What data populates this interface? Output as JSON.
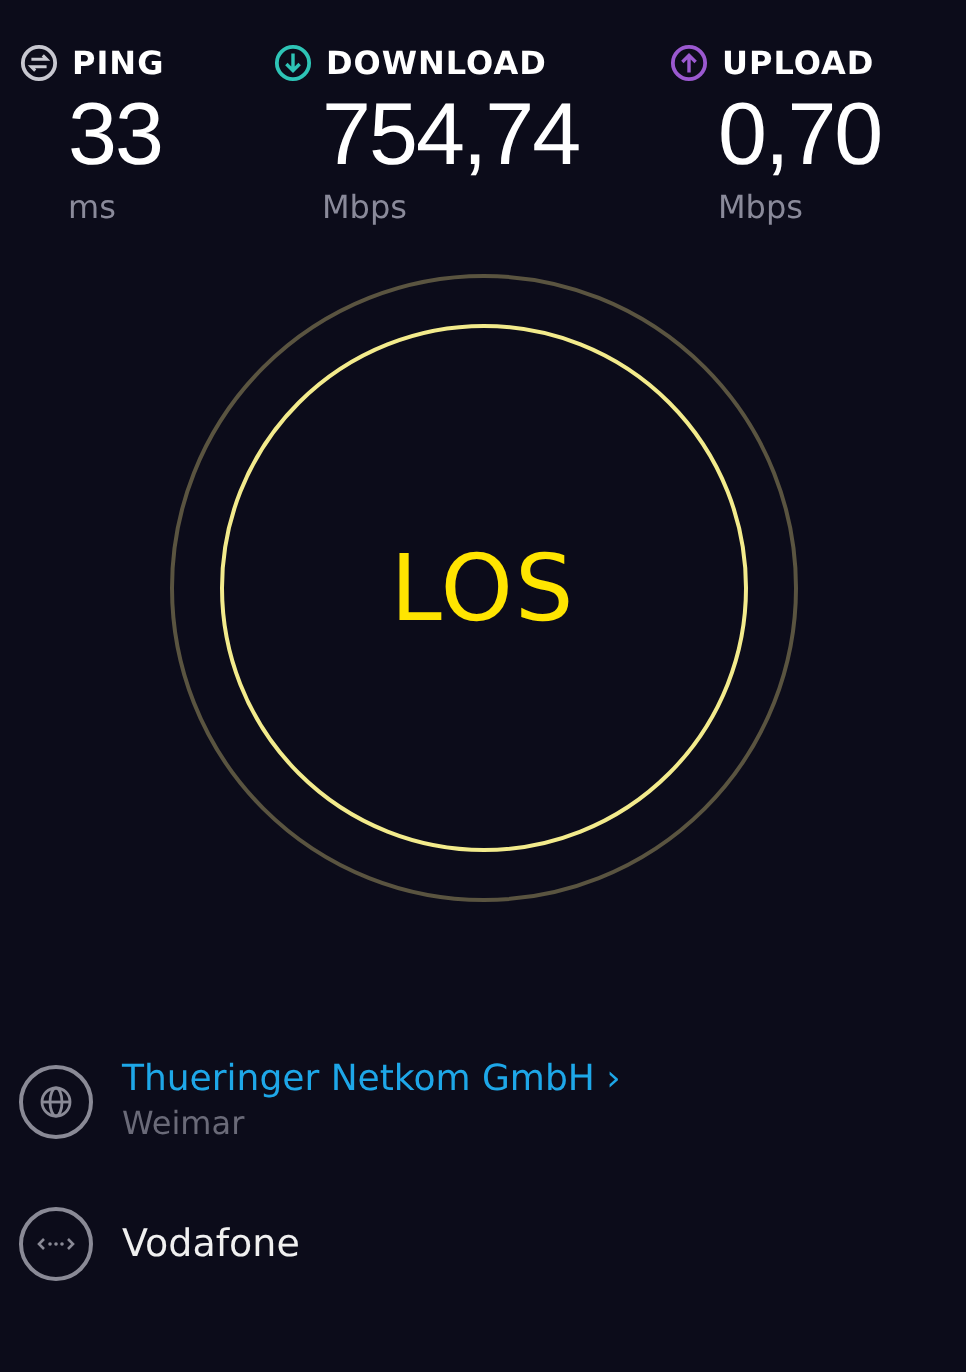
{
  "metrics": [
    {
      "kind": "ping",
      "label": "PING",
      "value": "33",
      "unit": "ms"
    },
    {
      "kind": "download",
      "label": "DOWNLOAD",
      "value": "754,74",
      "unit": "Mbps"
    },
    {
      "kind": "upload",
      "label": "UPLOAD",
      "value": "0,70",
      "unit": "Mbps"
    }
  ],
  "start_button": {
    "label": "LOS"
  },
  "provider": {
    "name": "Thueringer Netkom GmbH",
    "chevron": "›",
    "location": "Weimar"
  },
  "carrier": {
    "name": "Vodafone"
  }
}
